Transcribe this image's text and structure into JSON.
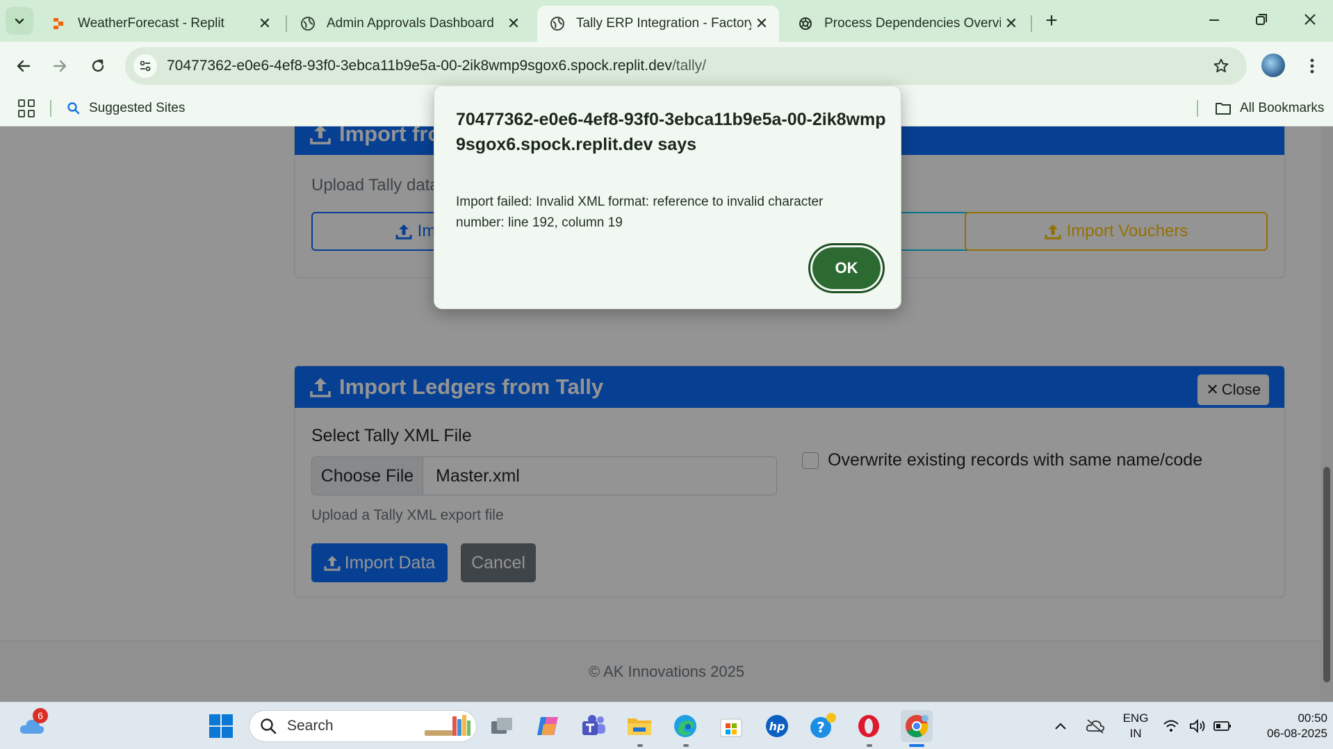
{
  "browser": {
    "tabs": [
      {
        "title": "WeatherForecast - Replit",
        "active": false
      },
      {
        "title": "Admin Approvals Dashboard",
        "active": false
      },
      {
        "title": "Tally ERP Integration - Factory M",
        "active": true
      },
      {
        "title": "Process Dependencies Overview",
        "active": false
      }
    ],
    "url_host": "70477362-e0e6-4ef8-93f0-3ebca11b9e5a-00-2ik8wmp9sgox6.spock.replit.dev",
    "url_path": "/tally/",
    "bookmarks": {
      "suggested_sites": "Suggested Sites",
      "all_bookmarks": "All Bookmarks"
    }
  },
  "page": {
    "import_card_top": {
      "header": "Import fro",
      "subtitle": "Upload Tally data",
      "btn_left": "Im",
      "btn_vouchers": "Import Vouchers"
    },
    "ledger_card": {
      "header": "Import Ledgers from Tally",
      "close_label": "Close",
      "file_label": "Select Tally XML File",
      "choose_file": "Choose File",
      "file_name": "Master.xml",
      "help_text": "Upload a Tally XML export file",
      "overwrite_label": "Overwrite existing records with same name/code",
      "overwrite_checked": false,
      "import_button": "Import Data",
      "cancel_button": "Cancel"
    },
    "footer": "© AK Innovations 2025"
  },
  "dialog": {
    "title": "70477362-e0e6-4ef8-93f0-3ebca11b9e5a-00-2ik8wmp9sgox6.spock.replit.dev says",
    "message": "Import failed: Invalid XML format: reference to invalid character number: line 192, column 19",
    "ok_label": "OK"
  },
  "taskbar": {
    "search_placeholder": "Search",
    "weather_badge": "6",
    "lang_line1": "ENG",
    "lang_line2": "IN",
    "time": "00:50",
    "date": "06-08-2025"
  },
  "colors": {
    "primary": "#0d6efd",
    "warning": "#ffc107",
    "chrome_green": "#d3ecd5",
    "ok_button": "#2d6a32"
  }
}
